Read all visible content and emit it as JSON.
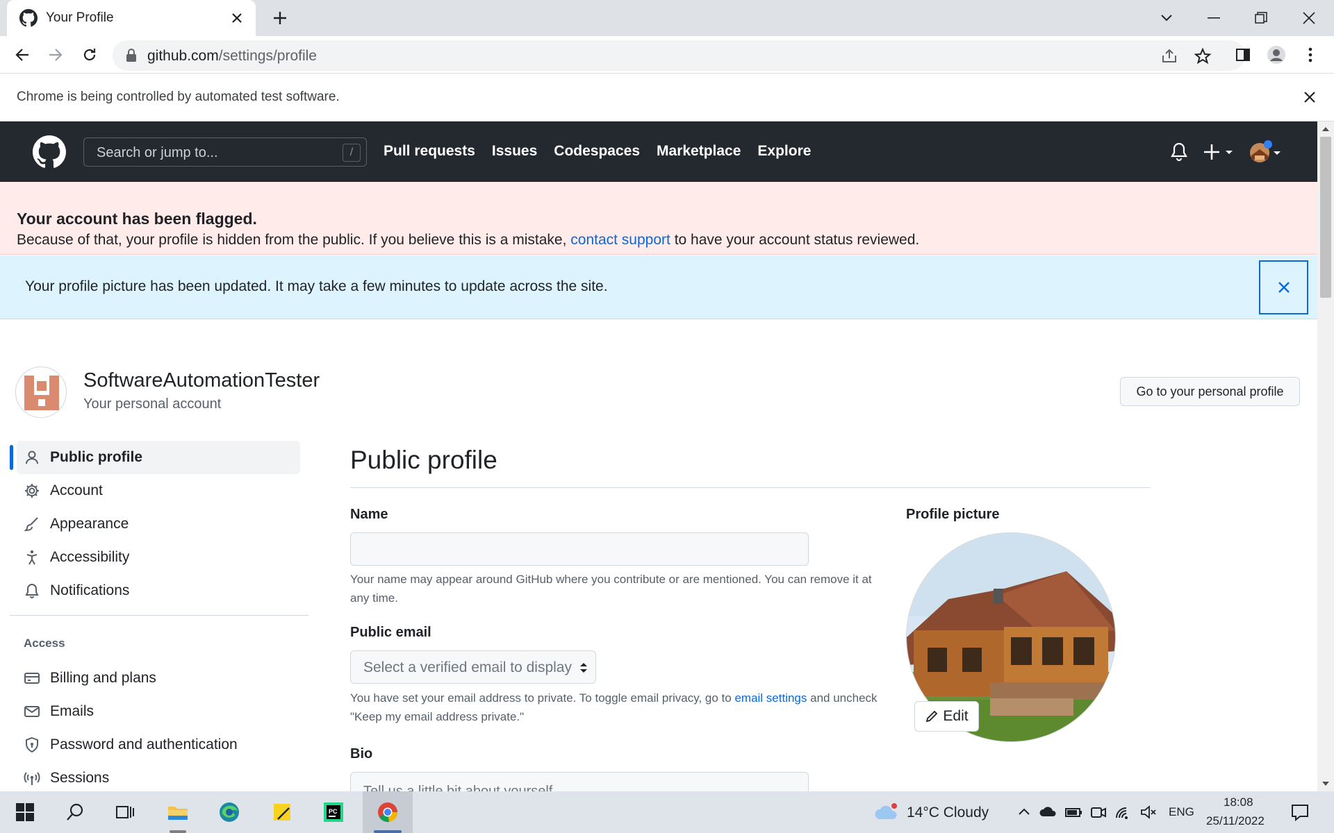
{
  "browser": {
    "tab_title": "Your Profile",
    "url_host": "github.com",
    "url_path": "/settings/profile",
    "infobar_text": "Chrome is being controlled by automated test software."
  },
  "github": {
    "search_placeholder": "Search or jump to...",
    "search_shortcut": "/",
    "nav": [
      "Pull requests",
      "Issues",
      "Codespaces",
      "Marketplace",
      "Explore"
    ]
  },
  "flag_banner": {
    "title": "Your account has been flagged.",
    "body_before": "Because of that, your profile is hidden from the public. If you believe this is a mistake,",
    "link": "contact support",
    "body_after": "to have your account status reviewed."
  },
  "flash": {
    "text": "Your profile picture has been updated. It may take a few minutes to update across the site."
  },
  "account": {
    "name": "SoftwareAutomationTester",
    "subtitle": "Your personal account",
    "go_profile_label": "Go to your personal profile"
  },
  "sidebar": {
    "items": [
      {
        "label": "Public profile",
        "icon": "person-icon",
        "active": true
      },
      {
        "label": "Account",
        "icon": "gear-icon"
      },
      {
        "label": "Appearance",
        "icon": "paintbrush-icon"
      },
      {
        "label": "Accessibility",
        "icon": "accessibility-icon"
      },
      {
        "label": "Notifications",
        "icon": "bell-icon"
      }
    ],
    "section_access": "Access",
    "access_items": [
      {
        "label": "Billing and plans",
        "icon": "credit-card-icon"
      },
      {
        "label": "Emails",
        "icon": "mail-icon"
      },
      {
        "label": "Password and authentication",
        "icon": "shield-lock-icon"
      },
      {
        "label": "Sessions",
        "icon": "broadcast-icon"
      }
    ]
  },
  "main": {
    "title": "Public profile",
    "name_label": "Name",
    "name_value": "",
    "name_note": "Your name may appear around GitHub where you contribute or are mentioned. You can remove it at any time.",
    "email_label": "Public email",
    "email_select": "Select a verified email to display",
    "email_note_before": "You have set your email address to private. To toggle email privacy, go to",
    "email_note_link": "email settings",
    "email_note_after": "and uncheck \"Keep my email address private.\"",
    "bio_label": "Bio",
    "bio_placeholder": "Tell us a little bit about yourself",
    "picture_label": "Profile picture",
    "edit_label": "Edit"
  },
  "taskbar": {
    "weather": "14°C  Cloudy",
    "lang": "ENG",
    "time": "18:08",
    "date": "25/11/2022"
  },
  "colors": {
    "github_header": "#24292f",
    "flag_bg": "#ffebe9",
    "flash_bg": "#ddf4ff",
    "link": "#0969da",
    "active_bar": "#0969da"
  }
}
